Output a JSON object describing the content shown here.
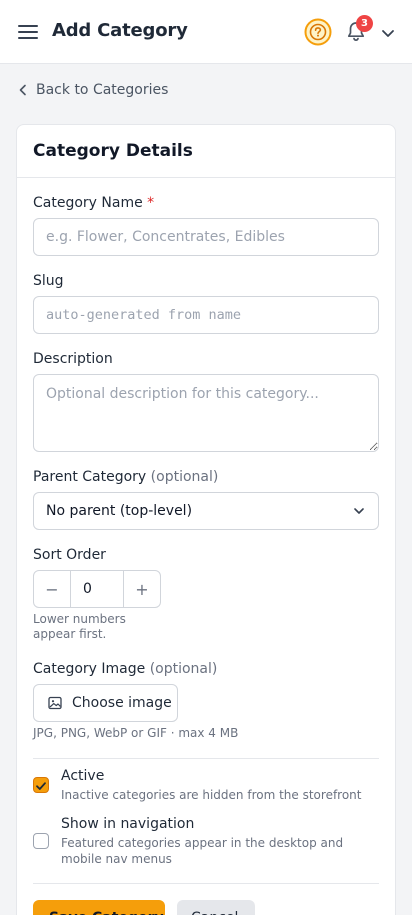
{
  "header": {
    "title": "Add Category",
    "notification_count": "3",
    "accent_color": "#f59e0b"
  },
  "nav": {
    "back_label": "Back to Categories"
  },
  "form": {
    "card_title": "Category Details",
    "name": {
      "label": "Category Name",
      "required_mark": "*",
      "placeholder": "e.g. Flower, Concentrates, Edibles",
      "value": ""
    },
    "slug": {
      "label": "Slug",
      "placeholder": "auto-generated from name",
      "value": ""
    },
    "description": {
      "label": "Description",
      "placeholder": "Optional description for this category...",
      "value": ""
    },
    "parent": {
      "label": "Parent Category",
      "optional": "(optional)",
      "selected": "No parent (top-level)"
    },
    "sort_order": {
      "label": "Sort Order",
      "value": "0",
      "minus": "−",
      "plus": "+",
      "help_line1": "Lower numbers",
      "help_line2": "appear first."
    },
    "image": {
      "label": "Category Image",
      "optional": "(optional)",
      "button_label": "Choose image",
      "help": "JPG, PNG, WebP or GIF · max 4 MB"
    },
    "active": {
      "label": "Active",
      "checked": true,
      "description": "Inactive categories are hidden from the storefront"
    },
    "show_in_nav": {
      "label": "Show in navigation",
      "checked": false,
      "description": "Featured categories appear in the desktop and mobile nav menus"
    }
  },
  "actions": {
    "save_label": "Save Category",
    "cancel_label": "Cancel"
  }
}
